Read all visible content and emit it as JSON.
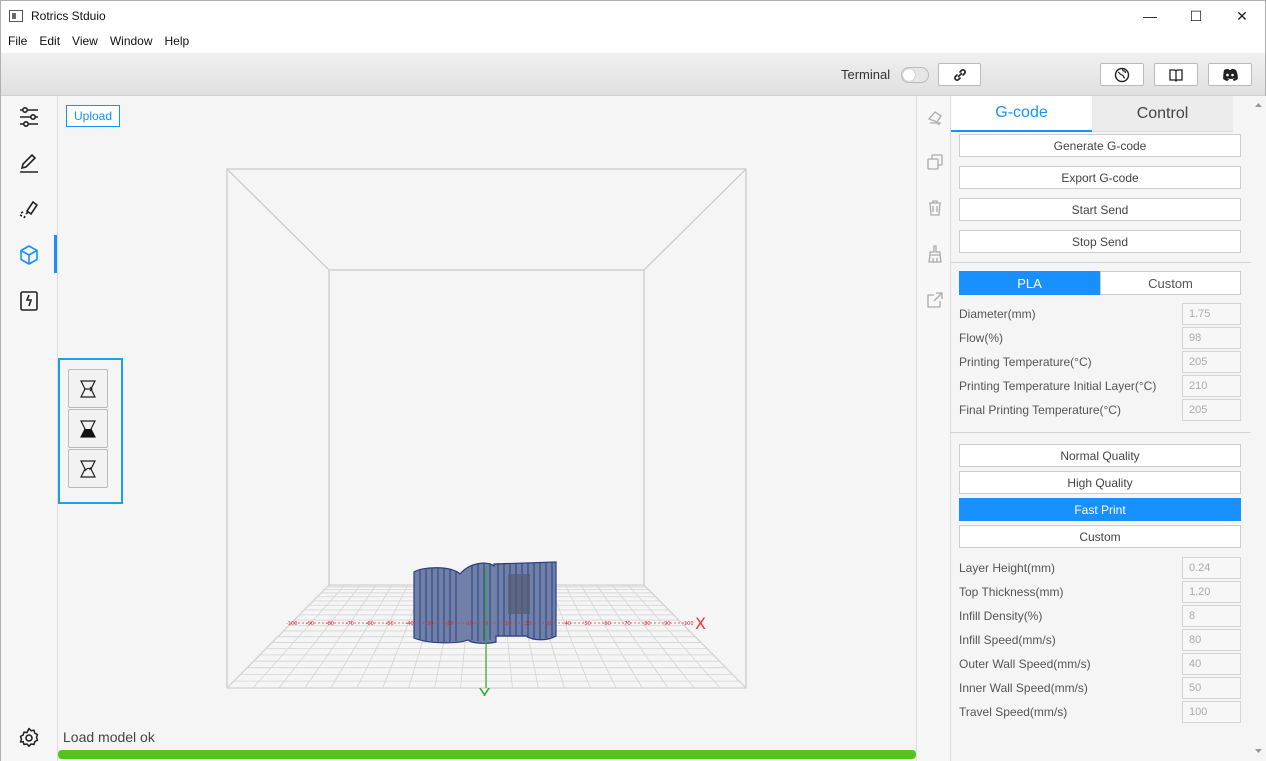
{
  "window": {
    "title": "Rotrics Stduio",
    "minimize": "—",
    "maximize": "☐",
    "close": "✕"
  },
  "menu": [
    "File",
    "Edit",
    "View",
    "Window",
    "Help"
  ],
  "toolbar": {
    "terminal_label": "Terminal",
    "terminal_on": false
  },
  "viewport": {
    "upload_label": "Upload",
    "status": "Load model ok",
    "progress_percent": 100,
    "axis_x_label": "X",
    "axis_y_label": "Y",
    "ruler_ticks": [
      "-100",
      "-90",
      "-80",
      "-70",
      "-60",
      "-50",
      "-40",
      "-30",
      "-20",
      "-10",
      "0",
      "10",
      "20",
      "30",
      "40",
      "50",
      "60",
      "70",
      "80",
      "90",
      "100"
    ]
  },
  "panel": {
    "tabs": [
      "G-code",
      "Control"
    ],
    "active_tab": "G-code",
    "actions": [
      "Generate G-code",
      "Export G-code",
      "Start Send",
      "Stop Send"
    ],
    "material_tabs": [
      "PLA",
      "Custom"
    ],
    "material_params": [
      {
        "label": "Diameter(mm)",
        "value": "1.75"
      },
      {
        "label": "Flow(%)",
        "value": "98"
      },
      {
        "label": "Printing Temperature(°C)",
        "value": "205"
      },
      {
        "label": "Printing Temperature Initial Layer(°C)",
        "value": "210"
      },
      {
        "label": "Final Printing Temperature(°C)",
        "value": "205"
      }
    ],
    "quality_options": [
      "Normal Quality",
      "High Quality",
      "Fast Print",
      "Custom"
    ],
    "active_quality": "Fast Print",
    "print_params": [
      {
        "label": "Layer Height(mm)",
        "value": "0.24"
      },
      {
        "label": "Top Thickness(mm)",
        "value": "1.20"
      },
      {
        "label": "Infill Density(%)",
        "value": "8"
      },
      {
        "label": "Infill Speed(mm/s)",
        "value": "80"
      },
      {
        "label": "Outer Wall Speed(mm/s)",
        "value": "40"
      },
      {
        "label": "Inner Wall Speed(mm/s)",
        "value": "50"
      },
      {
        "label": "Travel Speed(mm/s)",
        "value": "100"
      }
    ]
  },
  "colors": {
    "accent": "#1890ff",
    "progress": "#52c41a",
    "model": "#3e5aa0",
    "axis_x": "#e33",
    "axis_y": "#3a3"
  }
}
